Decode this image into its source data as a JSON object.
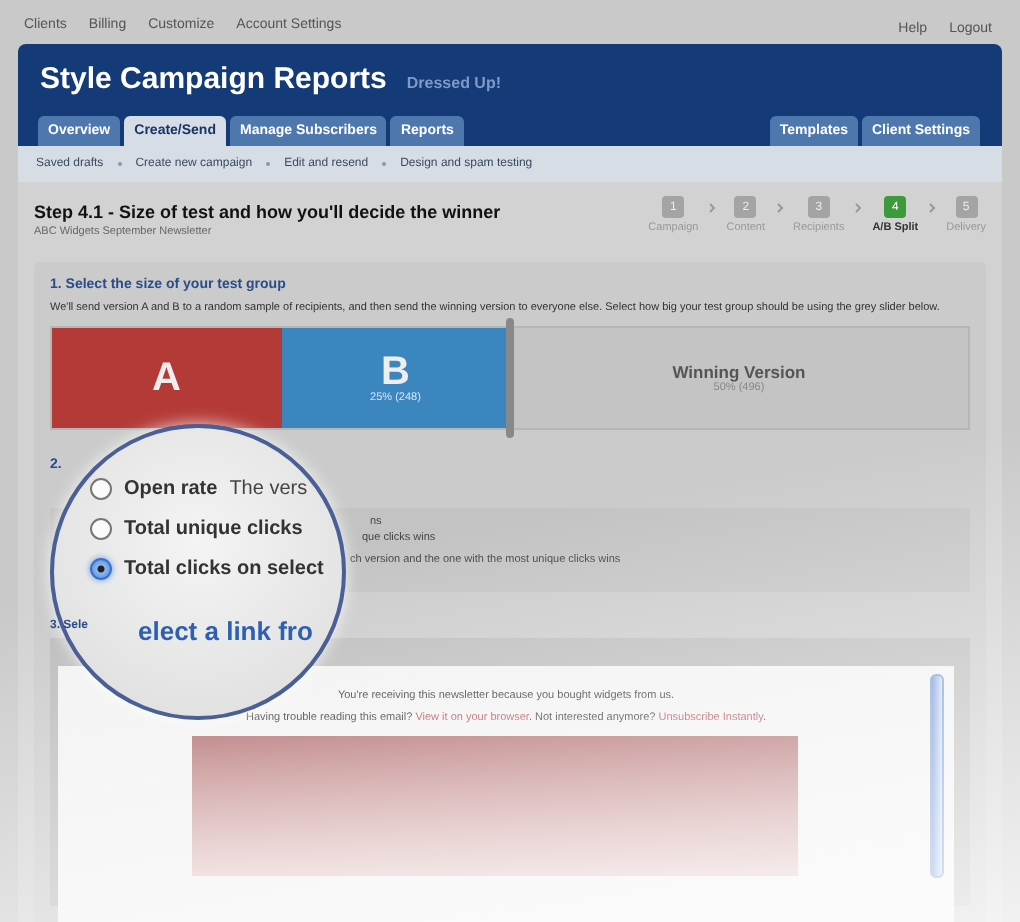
{
  "top_nav": {
    "left": [
      "Clients",
      "Billing",
      "Customize",
      "Account Settings"
    ],
    "right": [
      "Help",
      "Logout"
    ]
  },
  "header": {
    "title": "Style Campaign Reports",
    "subtitle": "Dressed Up!"
  },
  "tabs": [
    {
      "label": "Overview",
      "selected": false
    },
    {
      "label": "Create/Send",
      "selected": true
    },
    {
      "label": "Manage Subscribers",
      "selected": false
    },
    {
      "label": "Reports",
      "selected": false
    }
  ],
  "right_tabs": [
    {
      "label": "Templates",
      "selected": false
    },
    {
      "label": "Client Settings",
      "selected": false
    }
  ],
  "subnav": [
    "Saved drafts",
    "Create new campaign",
    "Edit and resend",
    "Design and spam testing"
  ],
  "step": {
    "title": "Step 4.1 - Size of test and how you'll decide the winner",
    "subtitle": "ABC Widgets September Newsletter"
  },
  "progress": [
    {
      "number": "1",
      "label": "Campaign",
      "selected": false
    },
    {
      "number": "2",
      "label": "Content",
      "selected": false
    },
    {
      "number": "3",
      "label": "Recipients",
      "selected": false
    },
    {
      "number": "4",
      "label": "A/B Split",
      "selected": true
    },
    {
      "number": "5",
      "label": "Delivery",
      "selected": false
    }
  ],
  "section1": {
    "heading": "1. Select the size of your test group",
    "text": "We'll send version A and B to a random sample of recipients, and then send the winning version to everyone else. Select how big your test group should be using the grey slider below.",
    "slider": {
      "level": 0.5,
      "a": {
        "label": "A"
      },
      "b": {
        "label": "B",
        "reading": "25% (248)"
      },
      "winner": {
        "label": "Winning Version",
        "reading": "50% (496)"
      }
    }
  },
  "section2": {
    "heading": "2.",
    "lines": [
      "ns",
      "que clicks wins",
      "ch version and the one with the most unique clicks wins"
    ]
  },
  "section3": {
    "heading": "3. Sele"
  },
  "email": {
    "intro": "You're receiving this newsletter because you bought widgets from us.",
    "line_before": "Having trouble reading this email? ",
    "link1": "View it on your browser",
    "line_middle": ". Not interested anymore? ",
    "link2": "Unsubscribe Instantly",
    "line_after": "."
  },
  "magnifier": {
    "options": [
      {
        "label": "Open rate",
        "note": "The vers",
        "selected": false
      },
      {
        "label": "Total unique clicks",
        "selected": false
      },
      {
        "label": "Total clicks on select",
        "selected": true
      }
    ],
    "heading": "elect a link fro"
  }
}
